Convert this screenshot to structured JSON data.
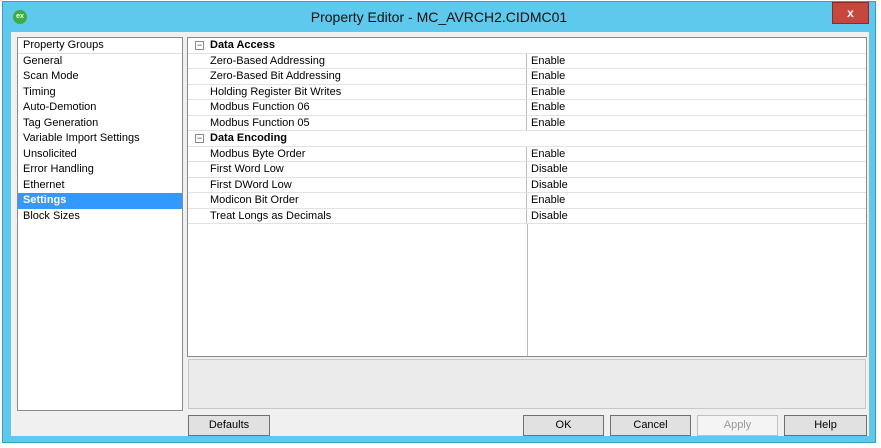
{
  "window": {
    "title": "Property Editor - MC_AVRCH2.CIDMC01",
    "icon_text": "ex",
    "close_label": "x"
  },
  "groups": {
    "header": "Property Groups",
    "items": [
      "General",
      "Scan Mode",
      "Timing",
      "Auto-Demotion",
      "Tag Generation",
      "Variable Import Settings",
      "Unsolicited",
      "Error Handling",
      "Ethernet",
      "Settings",
      "Block Sizes"
    ],
    "selected": "Settings"
  },
  "grid": {
    "categories": [
      {
        "name": "Data Access",
        "toggle": "−",
        "rows": [
          {
            "name": "Zero-Based Addressing",
            "value": "Enable"
          },
          {
            "name": "Zero-Based Bit Addressing",
            "value": "Enable"
          },
          {
            "name": "Holding Register Bit Writes",
            "value": "Enable"
          },
          {
            "name": "Modbus Function 06",
            "value": "Enable"
          },
          {
            "name": "Modbus Function 05",
            "value": "Enable"
          }
        ]
      },
      {
        "name": "Data Encoding",
        "toggle": "−",
        "rows": [
          {
            "name": "Modbus Byte Order",
            "value": "Enable"
          },
          {
            "name": "First Word Low",
            "value": "Disable"
          },
          {
            "name": "First DWord Low",
            "value": "Disable"
          },
          {
            "name": "Modicon Bit Order",
            "value": "Enable"
          },
          {
            "name": "Treat Longs as Decimals",
            "value": "Disable"
          }
        ]
      }
    ]
  },
  "buttons": {
    "defaults": "Defaults",
    "ok": "OK",
    "cancel": "Cancel",
    "apply": "Apply",
    "help": "Help"
  }
}
